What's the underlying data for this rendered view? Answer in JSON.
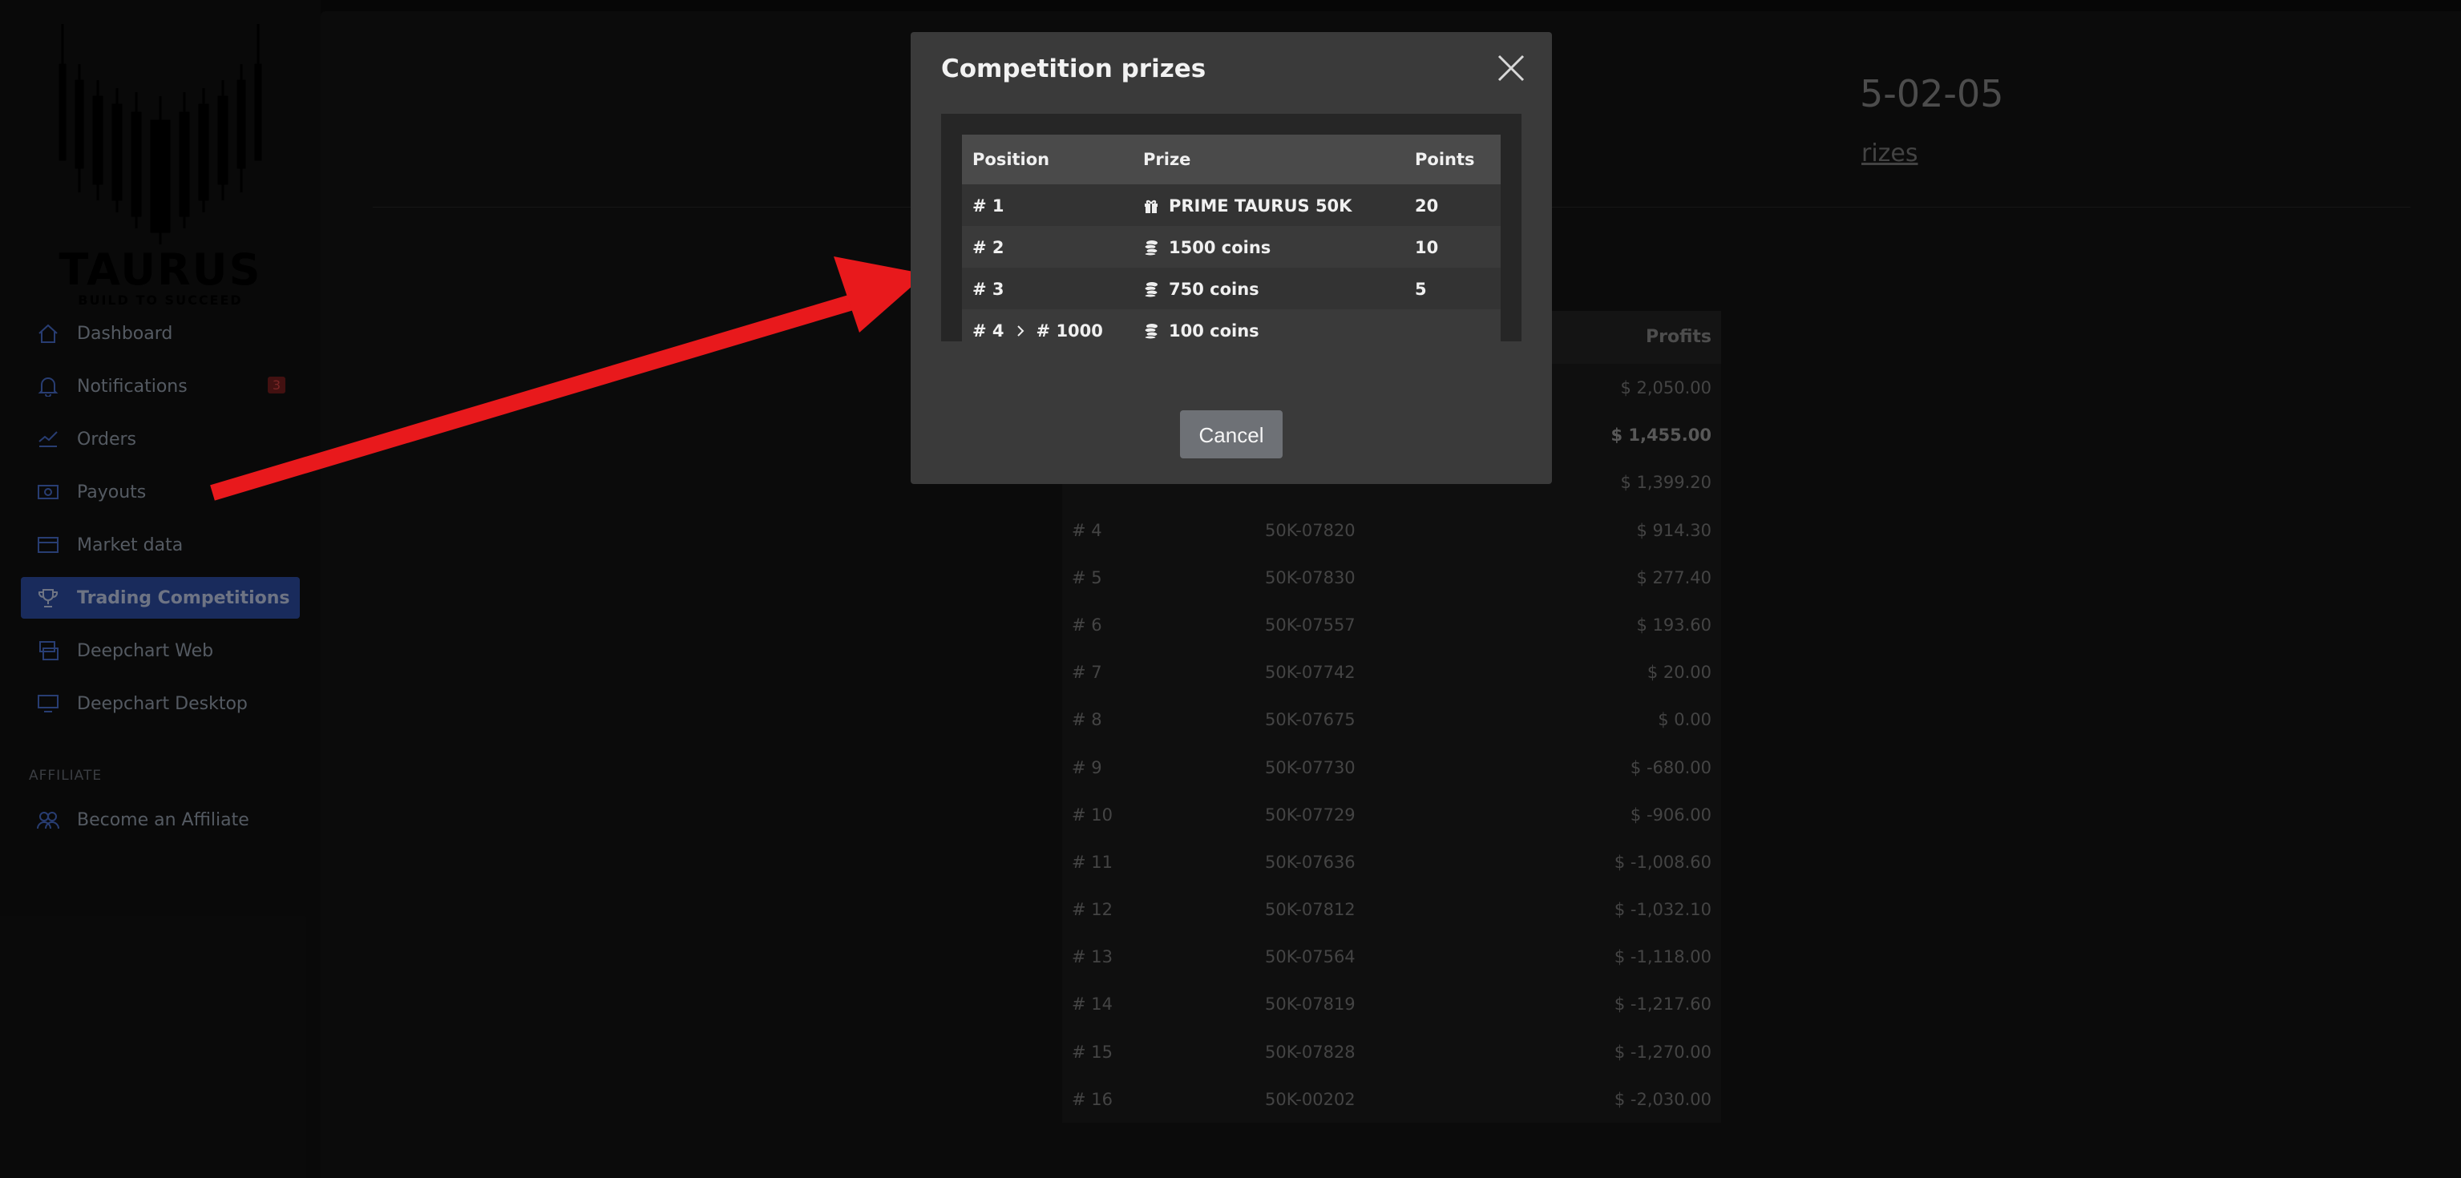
{
  "brand": {
    "name": "TAURUS",
    "tagline": "BUILD TO SUCCEED"
  },
  "sidebar": {
    "items": [
      {
        "label": "Dashboard",
        "icon": "home-icon"
      },
      {
        "label": "Notifications",
        "icon": "bell-icon",
        "badge": "3"
      },
      {
        "label": "Orders",
        "icon": "orders-icon"
      },
      {
        "label": "Payouts",
        "icon": "payout-icon"
      },
      {
        "label": "Market data",
        "icon": "card-icon"
      },
      {
        "label": "Trading Competitions",
        "icon": "trophy-icon",
        "active": true
      },
      {
        "label": "Deepchart Web",
        "icon": "web-icon"
      },
      {
        "label": "Deepchart Desktop",
        "icon": "desktop-icon"
      }
    ],
    "affiliate_section": "AFFILIATE",
    "affiliate_item": {
      "label": "Become an Affiliate",
      "icon": "users-icon"
    }
  },
  "main": {
    "date_partial": "5-02-05",
    "prizes_link_partial": "rizes",
    "ranking": {
      "profits_header": "Profits",
      "rows": [
        {
          "pos": "",
          "acct": "",
          "profit": "$ 2,050.00"
        },
        {
          "pos": "",
          "acct": "",
          "profit": "$ 1,455.00",
          "bold": true
        },
        {
          "pos": "",
          "acct": "",
          "profit": "$ 1,399.20"
        },
        {
          "pos": "# 4",
          "acct": "50K-07820",
          "profit": "$ 914.30"
        },
        {
          "pos": "# 5",
          "acct": "50K-07830",
          "profit": "$ 277.40"
        },
        {
          "pos": "# 6",
          "acct": "50K-07557",
          "profit": "$ 193.60"
        },
        {
          "pos": "# 7",
          "acct": "50K-07742",
          "profit": "$ 20.00"
        },
        {
          "pos": "# 8",
          "acct": "50K-07675",
          "profit": "$ 0.00"
        },
        {
          "pos": "# 9",
          "acct": "50K-07730",
          "profit": "$ -680.00"
        },
        {
          "pos": "# 10",
          "acct": "50K-07729",
          "profit": "$ -906.00"
        },
        {
          "pos": "# 11",
          "acct": "50K-07636",
          "profit": "$ -1,008.60"
        },
        {
          "pos": "# 12",
          "acct": "50K-07812",
          "profit": "$ -1,032.10"
        },
        {
          "pos": "# 13",
          "acct": "50K-07564",
          "profit": "$ -1,118.00"
        },
        {
          "pos": "# 14",
          "acct": "50K-07819",
          "profit": "$ -1,217.60"
        },
        {
          "pos": "# 15",
          "acct": "50K-07828",
          "profit": "$ -1,270.00"
        },
        {
          "pos": "# 16",
          "acct": "50K-00202",
          "profit": "$ -2,030.00"
        }
      ]
    }
  },
  "modal": {
    "title": "Competition prizes",
    "close_icon": "close-icon",
    "columns": {
      "position": "Position",
      "prize": "Prize",
      "points": "Points"
    },
    "rows": [
      {
        "position": "# 1",
        "prize": "PRIME TAURUS 50K",
        "icon": "gift-icon",
        "points": "20"
      },
      {
        "position": "# 2",
        "prize": "1500 coins",
        "icon": "coins-icon",
        "points": "10"
      },
      {
        "position": "# 3",
        "prize": "750 coins",
        "icon": "coins-icon",
        "points": "5"
      },
      {
        "position_from": "# 4",
        "position_to": "# 1000",
        "prize": "100 coins",
        "icon": "coins-icon",
        "points": ""
      }
    ],
    "cancel_label": "Cancel"
  },
  "annotation": {
    "arrow_color": "#e8191c"
  }
}
